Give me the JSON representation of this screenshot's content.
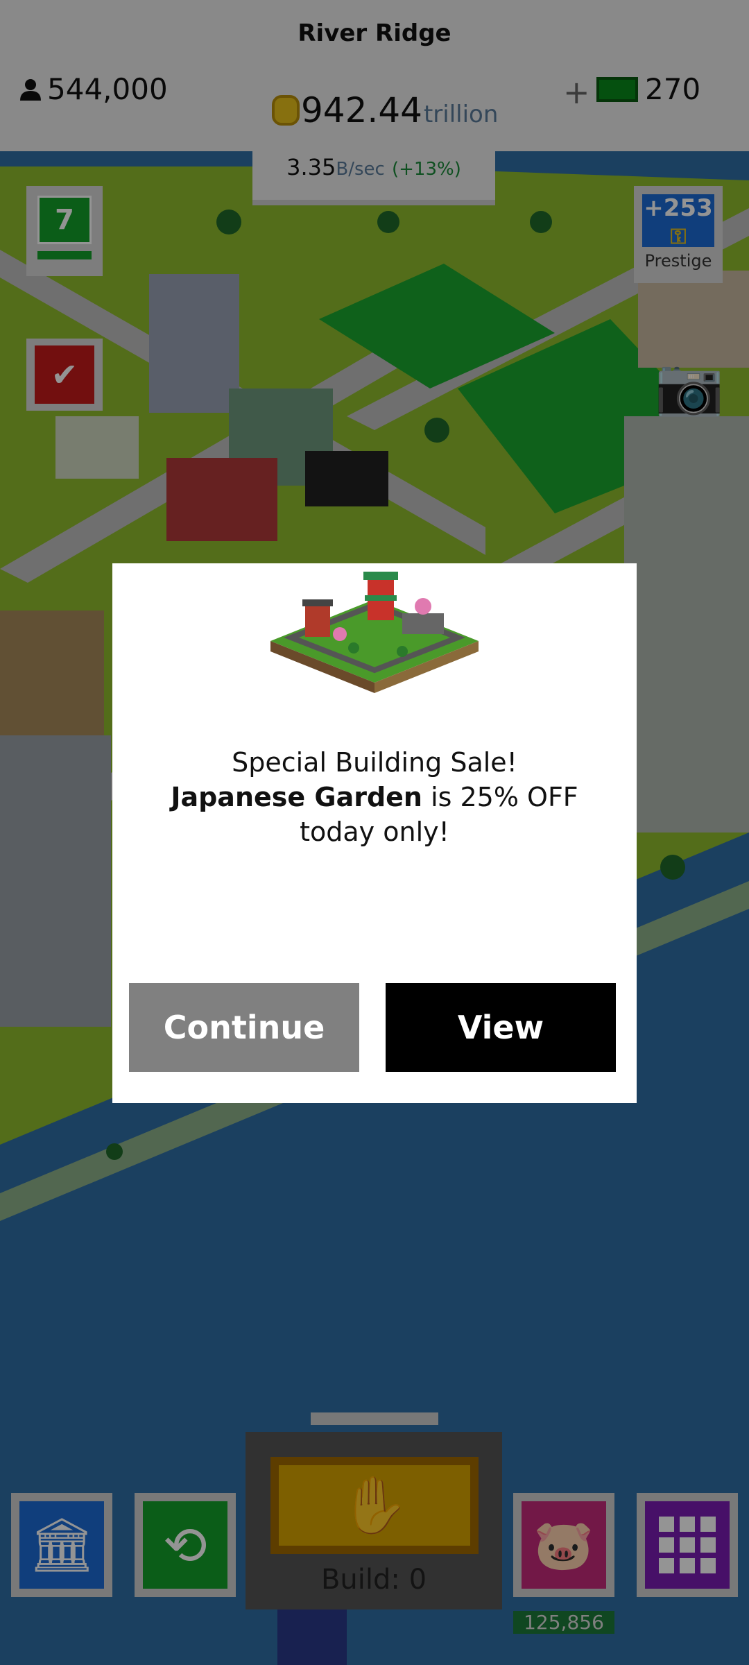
{
  "hud": {
    "city_name": "River Ridge",
    "population": "544,000",
    "money_value": "942.44",
    "money_unit": "trillion",
    "rate_value": "3.35",
    "rate_unit": "B/sec",
    "rate_bonus": "(+13%)",
    "plus": "+",
    "cash": "270",
    "level": "7",
    "prestige_value": "+253",
    "prestige_label": "Prestige"
  },
  "modal": {
    "line1": "Special Building Sale!",
    "building_name": "Japanese Garden",
    "line2_rest": " is 25% OFF today only!",
    "continue_label": "Continue",
    "view_label": "View"
  },
  "bottom_bar": {
    "build_label": "Build: 0",
    "piggy_count": "125,856"
  },
  "icons": {
    "population": "person-icon",
    "money": "coin-icon",
    "cash": "banknote-icon",
    "task": "checkmark-icon",
    "prestige": "key-icon",
    "camera": "camera-icon",
    "bank": "bank-icon",
    "time": "clock-icon",
    "build": "hammer-hand-icon",
    "piggy": "piggy-bank-icon",
    "grid": "grid-icon"
  },
  "colors": {
    "grass": "#8fbc2e",
    "water": "#2f6fa6",
    "road": "#bfbfbf",
    "green_tile": "#14a02a",
    "blue_tile": "#1d6bd6",
    "red_tile": "#c41a1a",
    "purple_tile": "#7a1db4",
    "pink_tile": "#c42a7a",
    "build_gold": "#d8a400"
  }
}
